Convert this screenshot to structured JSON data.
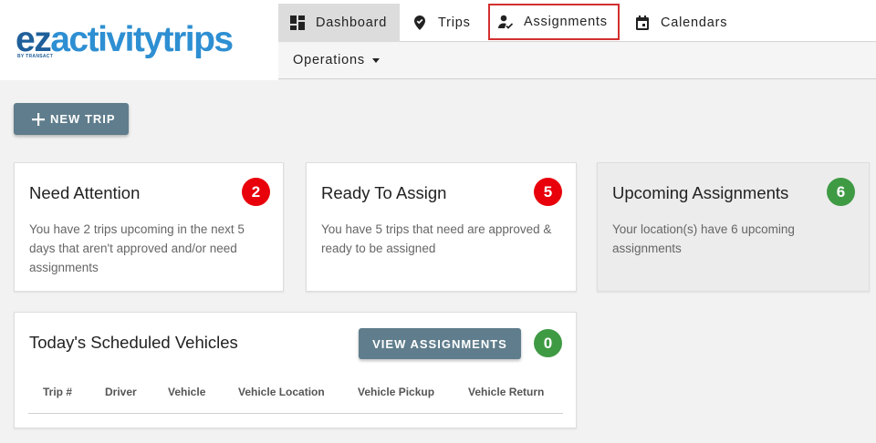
{
  "logo": {
    "ez": "ez",
    "rest": "activitytrips",
    "sub": "BY TRANSACT"
  },
  "nav": {
    "items": [
      {
        "label": "Dashboard",
        "icon": "dashboard-icon"
      },
      {
        "label": "Trips",
        "icon": "location-pin-icon"
      },
      {
        "label": "Assignments",
        "icon": "person-check-icon"
      },
      {
        "label": "Calendars",
        "icon": "calendar-icon"
      }
    ],
    "operations": "Operations"
  },
  "actions": {
    "new_trip": "NEW TRIP"
  },
  "cards": [
    {
      "title": "Need Attention",
      "count": "2",
      "text_lines": [
        "You have 2 trips upcoming in the next 5",
        "days that aren't approved and/or need",
        "assignments"
      ],
      "badge_color": "#e8000b"
    },
    {
      "title": "Ready To Assign",
      "count": "5",
      "text_lines": [
        "You have 5 trips that need are approved &",
        "ready to be assigned"
      ],
      "badge_color": "#e8000b"
    },
    {
      "title": "Upcoming Assignments",
      "count": "6",
      "text_lines": [
        "Your location(s) have 6 upcoming",
        "assignments"
      ],
      "badge_color": "#3f9a44"
    }
  ],
  "schedule": {
    "title": "Today's Scheduled Vehicles",
    "button": "VIEW ASSIGNMENTS",
    "count": "0",
    "columns": [
      "Trip #",
      "Driver",
      "Vehicle",
      "Vehicle Location",
      "Vehicle Pickup",
      "Vehicle Return"
    ]
  },
  "colors": {
    "accent_button": "#5f7d8c",
    "badge_red": "#e8000b",
    "badge_green": "#3f9a44",
    "highlight_border": "#d32f2f"
  }
}
